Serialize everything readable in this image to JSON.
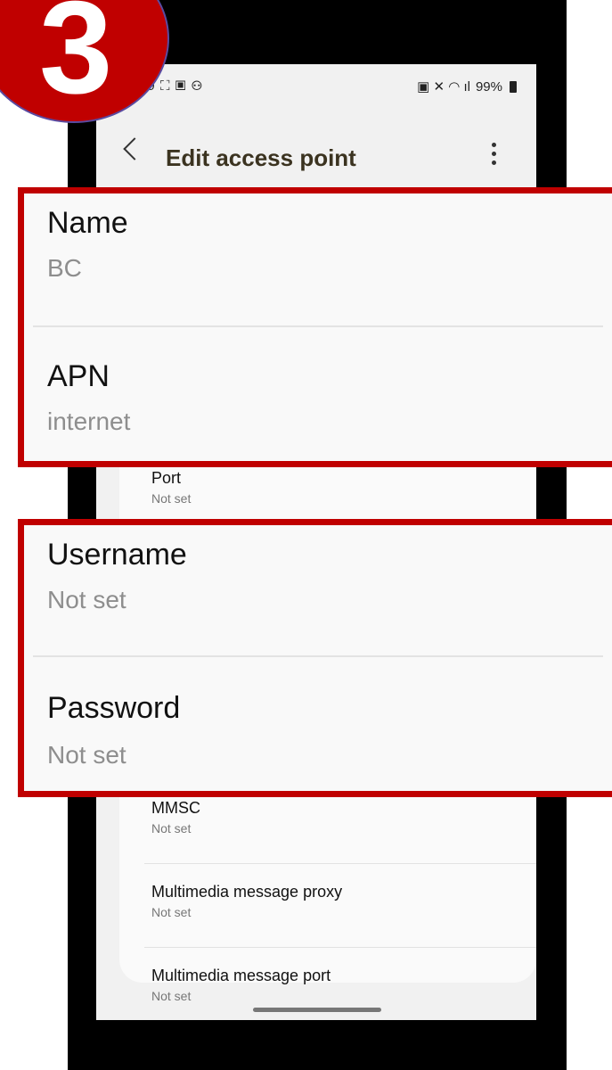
{
  "status": {
    "time": "29",
    "left_icons": "⛶ ▣ ⚇",
    "right_icons": "▣ ✕ ◠ ıl",
    "battery": "99%"
  },
  "appbar": {
    "title": "Edit access point"
  },
  "highlight_top": {
    "name_label": "Name",
    "name_value": "BC",
    "apn_label": "APN",
    "apn_value": "internet"
  },
  "port": {
    "label": "Port",
    "value": "Not set"
  },
  "highlight_bottom": {
    "username_label": "Username",
    "username_value": "Not set",
    "password_label": "Password",
    "password_value": "Not set"
  },
  "items": [
    {
      "label": "MMSC",
      "value": "Not set"
    },
    {
      "label": "Multimedia message proxy",
      "value": "Not set"
    },
    {
      "label": "Multimedia message port",
      "value": "Not set"
    }
  ],
  "step_badge": "3",
  "colors": {
    "highlight_border": "#c00000",
    "badge_fill": "#c00000",
    "title_text": "#3b3320"
  }
}
